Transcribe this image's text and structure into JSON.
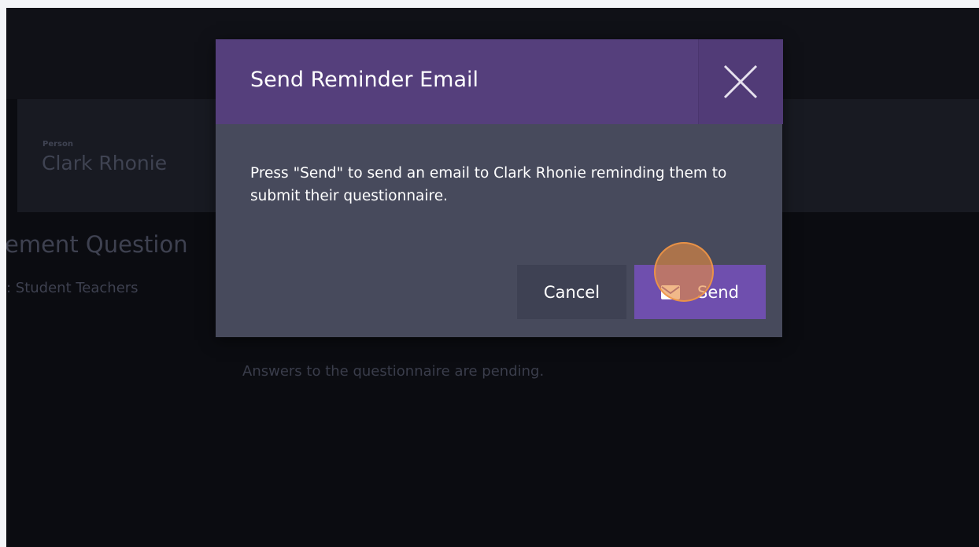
{
  "background": {
    "person_label": "Person",
    "person_name": "Clark Rhonie",
    "heading": "ement Question",
    "subheading": ": Student Teachers",
    "pending_message": "Answers to the questionnaire are pending."
  },
  "modal": {
    "title": "Send Reminder Email",
    "close_icon": "close-icon",
    "message": "Press \"Send\" to send an email to Clark Rhonie reminding them to submit their questionnaire.",
    "cancel_label": "Cancel",
    "send_label": "Send",
    "send_icon": "envelope-icon"
  },
  "colors": {
    "header": "#553f7c",
    "modal_body": "#474a5c",
    "send_button": "#6f4fae",
    "cancel_button": "#3e4153",
    "backdrop": "#0b0c11"
  }
}
